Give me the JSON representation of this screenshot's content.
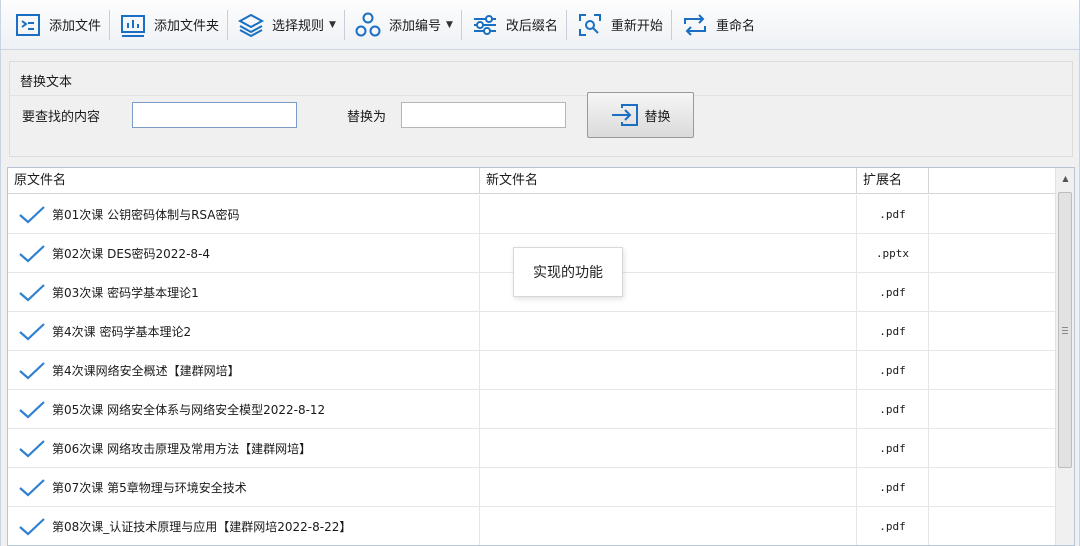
{
  "colors": {
    "accent": "#1a6fc2",
    "check": "#2f80d0"
  },
  "toolbar": {
    "items": [
      {
        "label": "添加文件",
        "icon": "add-file-icon"
      },
      {
        "label": "添加文件夹",
        "icon": "add-folder-chart-icon"
      },
      {
        "label": "选择规则",
        "icon": "layers-icon"
      },
      {
        "label": "添加编号",
        "icon": "numbering-icon"
      },
      {
        "label": "改后缀名",
        "icon": "sliders-icon"
      },
      {
        "label": "重新开始",
        "icon": "restart-scan-icon"
      },
      {
        "label": "重命名",
        "icon": "rename-arrows-icon"
      }
    ]
  },
  "replace": {
    "title": "替换文本",
    "find_label": "要查找的内容",
    "find_value": "",
    "replace_label": "替换为",
    "replace_value": "",
    "button_label": "替换"
  },
  "table": {
    "columns": [
      "原文件名",
      "新文件名",
      "扩展名"
    ],
    "rows": [
      {
        "orig": "第01次课 公钥密码体制与RSA密码",
        "new": "",
        "ext": ".pdf"
      },
      {
        "orig": "第02次课 DES密码2022-8-4",
        "new": "",
        "ext": ".pptx"
      },
      {
        "orig": "第03次课 密码学基本理论1",
        "new": "",
        "ext": ".pdf"
      },
      {
        "orig": "第4次课 密码学基本理论2",
        "new": "",
        "ext": ".pdf"
      },
      {
        "orig": "第4次课网络安全概述【建群网培】",
        "new": "",
        "ext": ".pdf"
      },
      {
        "orig": "第05次课 网络安全体系与网络安全模型2022-8-12",
        "new": "",
        "ext": ".pdf"
      },
      {
        "orig": "第06次课 网络攻击原理及常用方法【建群网培】",
        "new": "",
        "ext": ".pdf"
      },
      {
        "orig": "第07次课 第5章物理与环境安全技术",
        "new": "",
        "ext": ".pdf"
      },
      {
        "orig": "第08次课_认证技术原理与应用【建群网培2022-8-22】",
        "new": "",
        "ext": ".pdf"
      }
    ]
  },
  "tooltip": {
    "text": "实现的功能"
  }
}
